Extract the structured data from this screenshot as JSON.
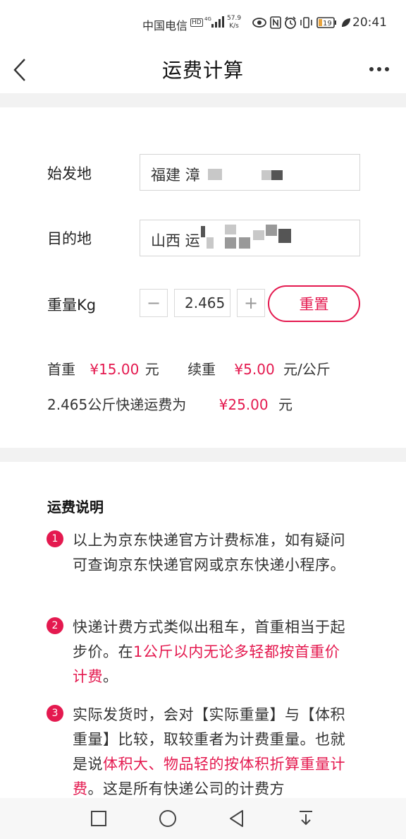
{
  "status_bar": {
    "carrier": "中国电信",
    "hd_badge": "HD",
    "network": "4G",
    "speed_value": "57.9",
    "speed_unit": "K/s",
    "battery": "19",
    "time": "20:41"
  },
  "header": {
    "title": "运费计算",
    "back_icon": "chevron-left-icon",
    "more_icon": "more-horizontal-icon"
  },
  "form": {
    "origin_label": "始发地",
    "origin_value": "福建 漳",
    "destination_label": "目的地",
    "destination_value": "山西 运",
    "weight_label": "重量Kg",
    "weight_minus": "−",
    "weight_value": "2.465",
    "weight_plus": "+",
    "reset_label": "重置"
  },
  "pricing": {
    "first_weight_label": "首重",
    "first_weight_price": "¥15.00",
    "first_weight_unit": "元",
    "continued_weight_label": "续重",
    "continued_weight_price": "¥5.00",
    "continued_weight_unit": "元/公斤",
    "total_label": "2.465公斤快递运费为",
    "total_price": "¥25.00",
    "total_unit": "元"
  },
  "notes": {
    "title": "运费说明",
    "items": [
      {
        "num": "1",
        "text": "以上为京东快递官方计费标准，如有疑问可查询京东快递官网或京东快递小程序。"
      },
      {
        "num": "2",
        "text_before": "快递计费方式类似出租车，首重相当于起步价。在",
        "text_highlight": "1公斤以内无论多轻都按首重价计费",
        "text_after": "。"
      },
      {
        "num": "3",
        "text_before": "实际发货时，会对【实际重量】与【体积重量】比较，取较重者为计费重量。也就是说",
        "text_highlight": "体积大、物品轻的按体积折算重量计费",
        "text_after": "。这是所有快递公司的计费方"
      }
    ]
  },
  "colors": {
    "accent": "#e4194f",
    "divider": "#f2f2f2"
  },
  "nav_bar": {
    "icons": [
      "square-icon",
      "circle-icon",
      "triangle-back-icon",
      "download-icon"
    ]
  }
}
